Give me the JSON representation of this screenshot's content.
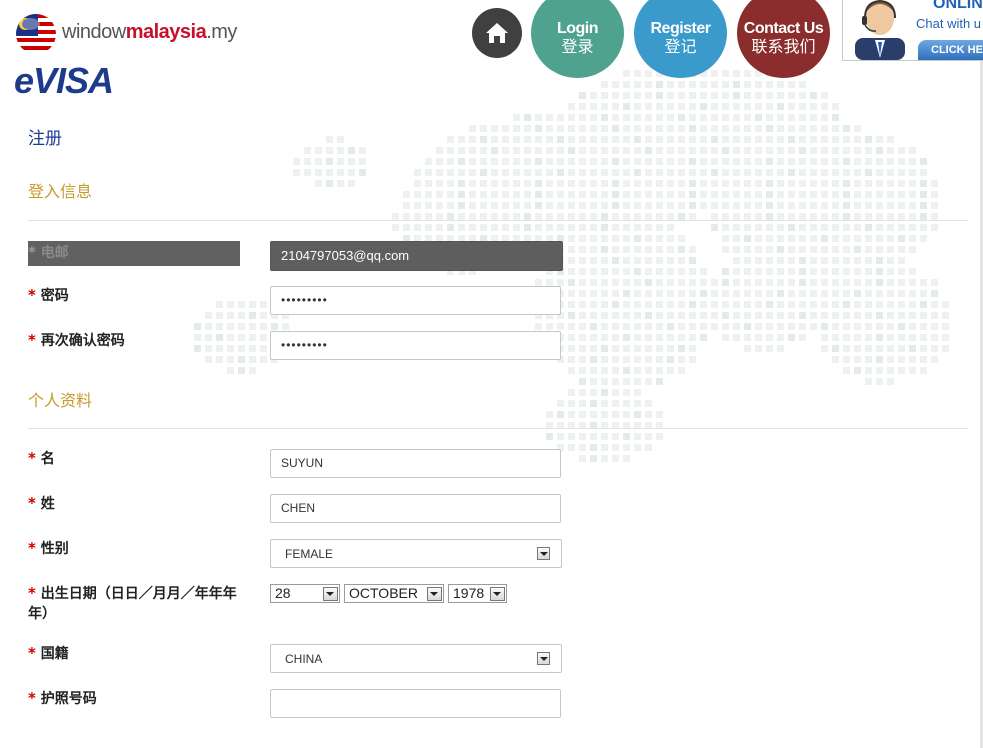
{
  "header": {
    "logo_prefix": "window",
    "logo_brand": "malaysia",
    "logo_suffix": ".my",
    "evisa_logo": "eVISA",
    "nav": {
      "home_icon": "home-icon",
      "login_en": "Login",
      "login_zh": "登录",
      "register_en": "Register",
      "register_zh": "登记",
      "contact_en": "Contact Us",
      "contact_zh": "联系我们"
    },
    "chat": {
      "online": "ONLIN",
      "with": "Chat with u",
      "button": "CLICK HE"
    }
  },
  "page_title": "注册",
  "sections": {
    "login_info": "登入信息",
    "personal_info": "个人资料"
  },
  "required_mark": "*",
  "fields": {
    "email": {
      "label": "电邮",
      "value": "2104797053@qq.com"
    },
    "password": {
      "label": "密码",
      "value": "•••••••••"
    },
    "confirm_password": {
      "label": "再次确认密码",
      "value": "•••••••••"
    },
    "first_name": {
      "label": "名",
      "value": "SUYUN"
    },
    "last_name": {
      "label": "姓",
      "value": "CHEN"
    },
    "gender": {
      "label": "性别",
      "value": "FEMALE"
    },
    "dob": {
      "label": "出生日期（日日／月月／年年年年）",
      "day": "28",
      "month": "OCTOBER",
      "year": "1978"
    },
    "nationality": {
      "label": "国籍",
      "value": "CHINA"
    },
    "passport": {
      "label": "护照号码",
      "value": ""
    }
  },
  "colors": {
    "title_blue": "#1e3c96",
    "section_gold": "#c99a2e",
    "required_red": "#cc0000",
    "login_green": "#4fa28e",
    "register_blue": "#3a9acb",
    "contact_red": "#8b2d2d",
    "home_dark": "#404040"
  }
}
